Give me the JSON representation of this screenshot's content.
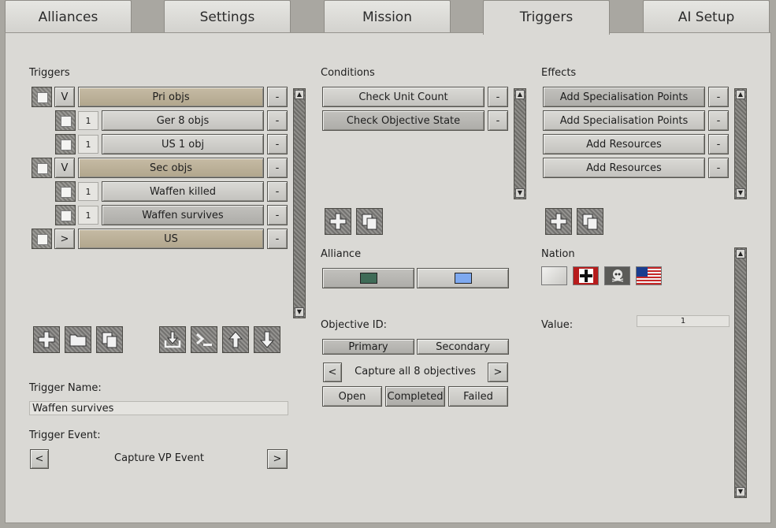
{
  "tabs": [
    "Alliances",
    "Settings",
    "Mission",
    "Triggers",
    "AI Setup"
  ],
  "triggers": {
    "label": "Triggers",
    "rows": [
      {
        "toggle": "V",
        "count": "",
        "name": "Pri objs",
        "kind": "group"
      },
      {
        "toggle": "",
        "count": "1",
        "name": "Ger 8 objs",
        "kind": "item"
      },
      {
        "toggle": "",
        "count": "1",
        "name": "US 1 obj",
        "kind": "item"
      },
      {
        "toggle": "V",
        "count": "",
        "name": "Sec objs",
        "kind": "group"
      },
      {
        "toggle": "",
        "count": "1",
        "name": "Waffen killed",
        "kind": "item"
      },
      {
        "toggle": "",
        "count": "1",
        "name": "Waffen survives",
        "kind": "item"
      },
      {
        "toggle": ">",
        "count": "",
        "name": "US",
        "kind": "group"
      }
    ],
    "remove_label": "-",
    "name_label": "Trigger Name:",
    "name_value": "Waffen survives",
    "event_label": "Trigger Event:",
    "event_value": "Capture VP Event",
    "prev": "<",
    "next": ">"
  },
  "conditions": {
    "label": "Conditions",
    "rows": [
      "Check Unit Count",
      "Check Objective State"
    ],
    "remove_label": "-",
    "alliance_label": "Alliance",
    "alliance_colors": [
      "#3f6b57",
      "#7ea9f0"
    ],
    "objective_label": "Objective ID:",
    "primary": "Primary",
    "secondary": "Secondary",
    "objective_value": "Capture all 8 objectives",
    "prev": "<",
    "next": ">",
    "states": [
      "Open",
      "Completed",
      "Failed"
    ]
  },
  "effects": {
    "label": "Effects",
    "rows": [
      "Add Specialisation Points",
      "Add Specialisation Points",
      "Add Resources",
      "Add Resources"
    ],
    "remove_label": "-",
    "nation_label": "Nation",
    "flags": [
      "blank-flag-icon",
      "german-cross-flag-icon",
      "skull-flag-icon",
      "us-flag-icon"
    ],
    "value_label": "Value:",
    "value": "1"
  }
}
